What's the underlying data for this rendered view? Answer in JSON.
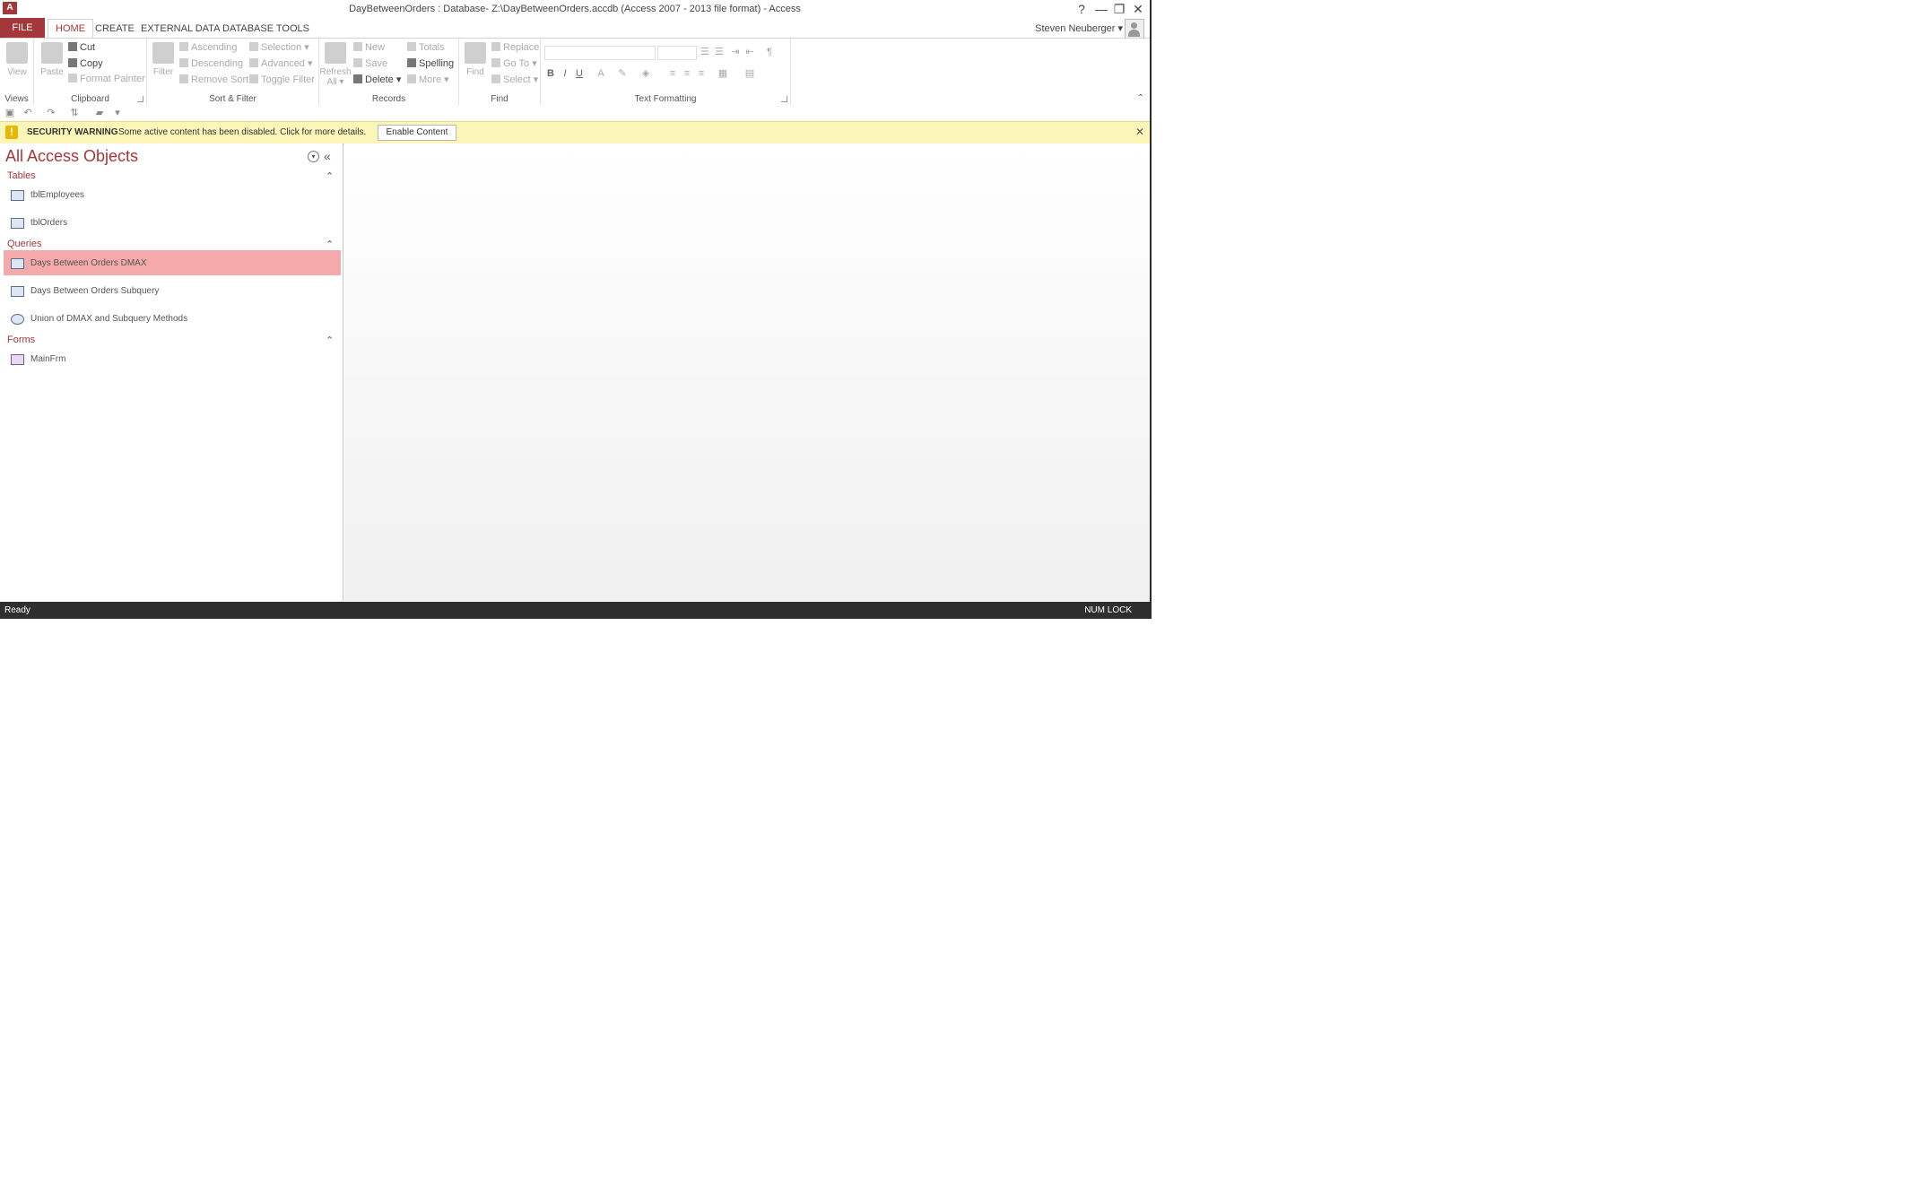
{
  "app": {
    "logo": "A",
    "title": "DayBetweenOrders : Database- Z:\\DayBetweenOrders.accdb (Access 2007 - 2013 file format) - Access",
    "help": "?",
    "minimize": "—",
    "restore": "❐",
    "close": "✕",
    "user": "Steven Neuberger ▾",
    "accent": "#a4373a"
  },
  "tabs": [
    "FILE",
    "HOME",
    "CREATE",
    "EXTERNAL DATA",
    "DATABASE TOOLS"
  ],
  "ribbon": {
    "views": {
      "view": "View",
      "label": "Views"
    },
    "clipboard": {
      "paste": "Paste",
      "cut": "Cut",
      "copy": "Copy",
      "format_painter": "Format Painter",
      "label": "Clipboard"
    },
    "sort_filter": {
      "filter": "Filter",
      "ascending": "Ascending",
      "descending": "Descending",
      "remove_sort": "Remove Sort",
      "selection": "Selection ▾",
      "advanced": "Advanced ▾",
      "toggle_filter": "Toggle Filter",
      "label": "Sort & Filter"
    },
    "records": {
      "refresh": "Refresh",
      "refresh2": "All ▾",
      "new": "New",
      "save": "Save",
      "delete": "Delete ▾",
      "totals": "Totals",
      "spelling": "Spelling",
      "more": "More ▾",
      "label": "Records"
    },
    "find": {
      "find": "Find",
      "replace": "Replace",
      "goto": "Go To ▾",
      "select": "Select ▾",
      "label": "Find"
    },
    "text_formatting": {
      "bold": "B",
      "italic": "I",
      "underline": "U",
      "label": "Text Formatting"
    }
  },
  "security": {
    "title": "SECURITY WARNING",
    "message": "Some active content has been disabled. Click for more details.",
    "button": "Enable Content",
    "color": "#fbf6b8"
  },
  "nav": {
    "title": "All Access Objects",
    "sections": {
      "tables": {
        "label": "Tables",
        "items": [
          "tblEmployees",
          "tblOrders"
        ]
      },
      "queries": {
        "label": "Queries",
        "items": [
          "Days Between Orders DMAX",
          "Days Between Orders Subquery",
          "Union of DMAX and Subquery Methods"
        ]
      },
      "forms": {
        "label": "Forms",
        "items": [
          "MainFrm"
        ]
      }
    },
    "selected_color": "#f4a9ab"
  },
  "status": {
    "left": "Ready",
    "right": "NUM LOCK"
  }
}
